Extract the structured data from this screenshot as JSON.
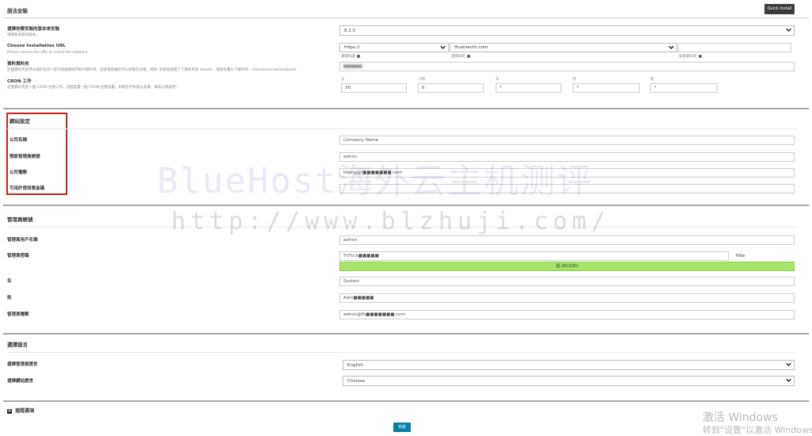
{
  "header": {
    "title": "語法安裝",
    "quick_install": "Quick Install"
  },
  "software": {
    "version_label": "選擇你要安裝的版本來安裝",
    "version_sub": "選擇要安裝的版本。",
    "version_value": "8.2.0",
    "url_label": "Choose Installation URL",
    "url_sub": "Please choose the URL to install the software",
    "protocol": "https://",
    "domain": "fhuelseufn.com",
    "protocol_hint": "選擇協議",
    "domain_hint": "選擇域名",
    "dir_hint": "安裝資料夾",
    "datadir_label": "資料資料夾",
    "datadir_sub": "這個資料夾是用以儲存您的一些可能被網站存取的資料夾。這是我建議您可以放置在這裡。例如: 如果您創建了了資料夾名 datadir，那麼位置以下資料夾 – /home/username/datadir",
    "cron_label": "CRON 工作",
    "cron_sub": "這個資料夾是一個 CRON 任務工作。這個設置一個 CRON 任務設置，如果您不知道以此填，填寫以預設吧!",
    "cron_heads": [
      "分",
      "小時",
      "日",
      "月",
      "周"
    ],
    "cron_values": [
      "36",
      "6",
      "*",
      "*",
      "*"
    ]
  },
  "site": {
    "title": "網站設定",
    "name_label": "公司名稱",
    "name_value": "Company Name",
    "admin_label": "預設管理員帳號",
    "admin_value": "admin",
    "email_label": "公司電郵",
    "email_value": "bkeng@f■■■■■■■.com",
    "extra_label": "可用於使用資金碼",
    "extra_value": ""
  },
  "admin": {
    "title": "管理員帳號",
    "user_label": "管理員用戶名稱",
    "user_value": "admin",
    "pass_label": "管理員密碼",
    "pass_value": "YV%c$■■■■■",
    "hide": "Hide",
    "strength": "強 (65/100)",
    "first_label": "名",
    "first_value": "System",
    "last_label": "姓",
    "last_value": "Adm■■■■■",
    "email_label": "管理員電郵",
    "email_value": "admin@fh■■■■■■■.com"
  },
  "lang": {
    "title": "選擇語言",
    "admin_label": "選擇管理員語言",
    "admin_value": "English",
    "site_label": "選擇網站語言",
    "site_value": "Chinese"
  },
  "advanced": {
    "label": "進階選項"
  },
  "install_button": "安裝",
  "watermark": {
    "brand": "BlueHost海外云主机测评",
    "url": "http://www.blzhuji.com/"
  },
  "activation": {
    "line1": "激活 Windows",
    "line2": "转到\"设置\"以激活 Windows。"
  },
  "colors": {
    "redbox": "#c8201c",
    "strength": "#a6e46a",
    "install": "#0a7fa6",
    "quick": "#3c3c3c"
  }
}
